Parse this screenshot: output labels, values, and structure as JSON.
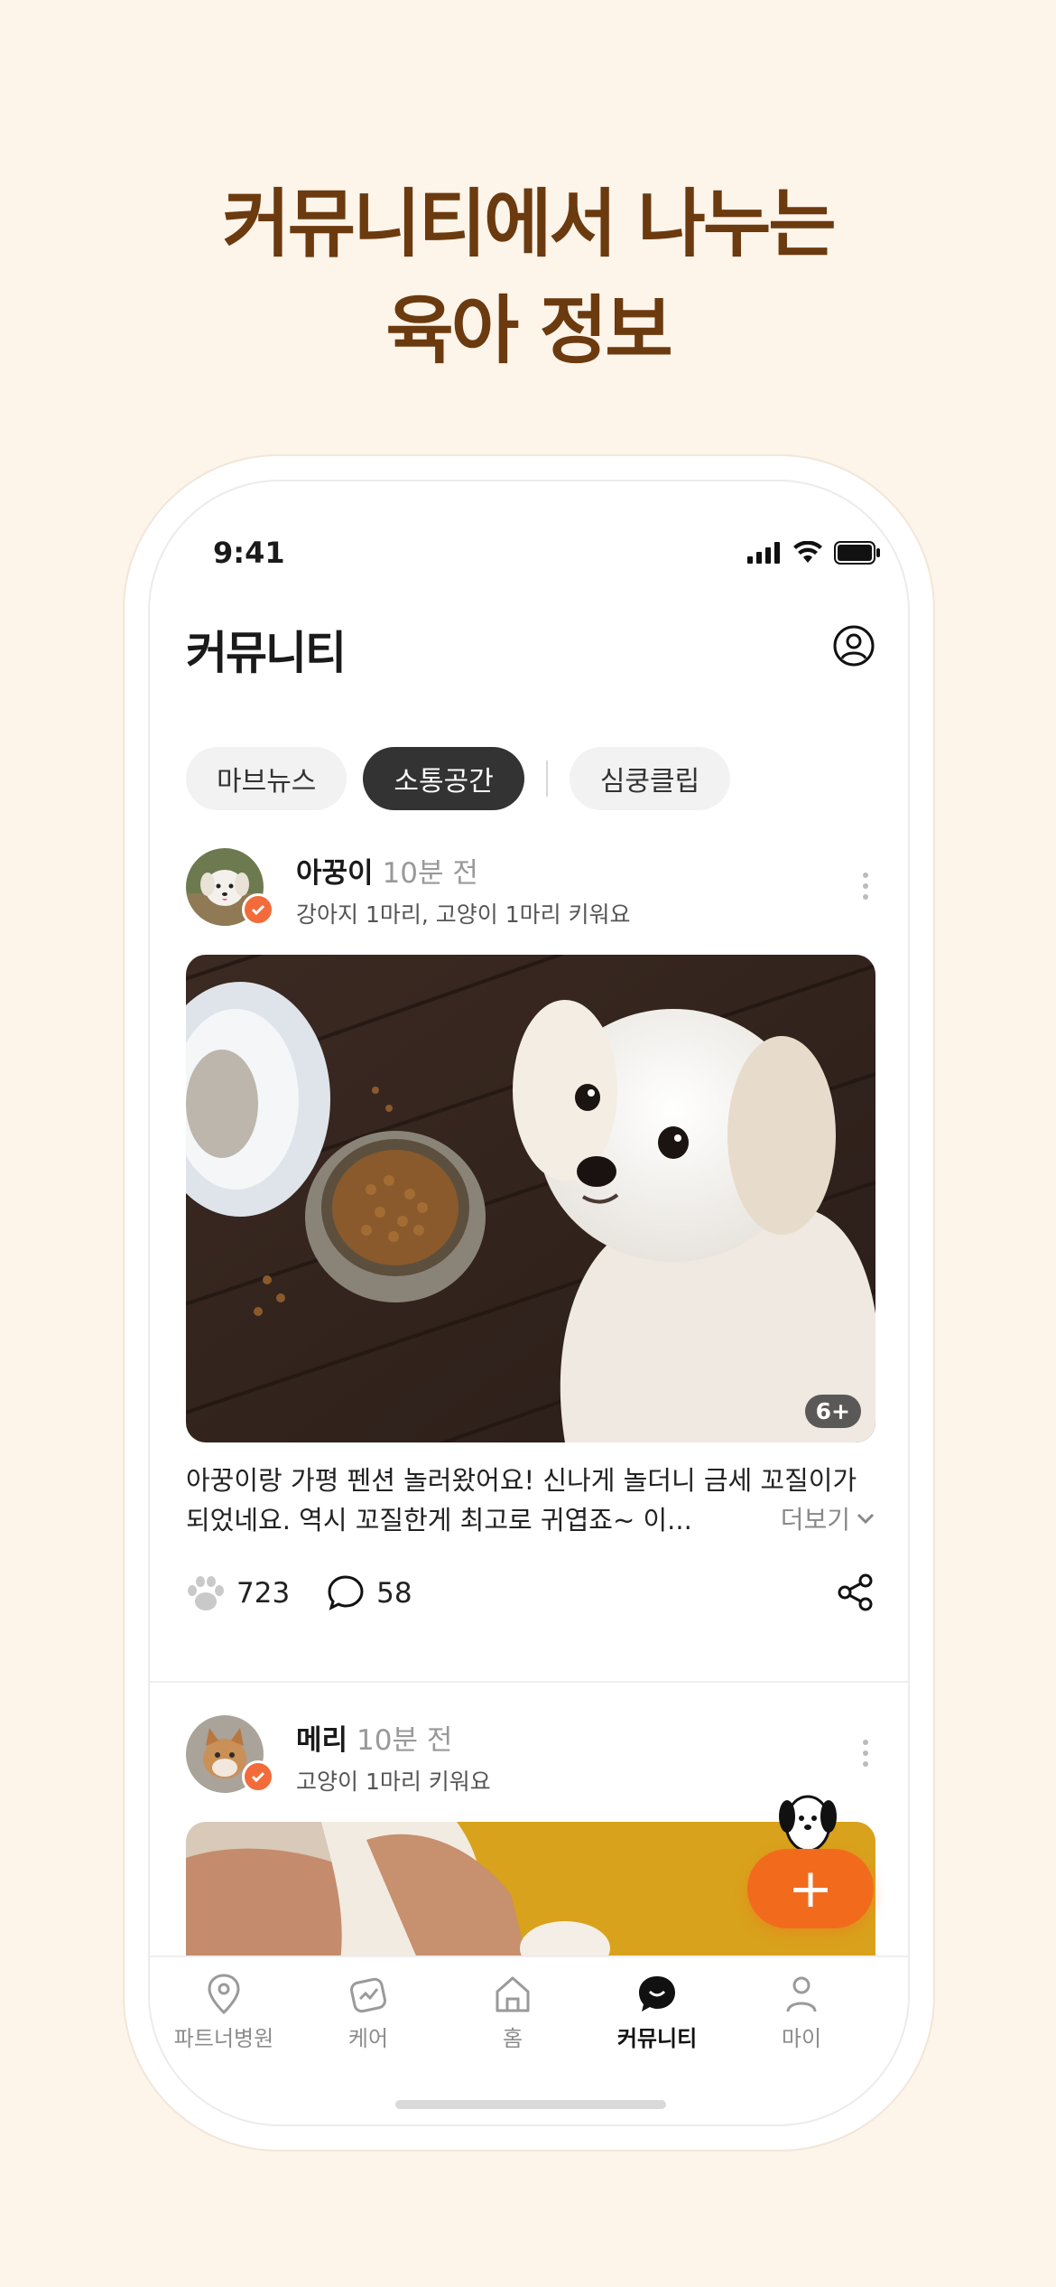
{
  "headline": {
    "line1": "커뮤니티에서 나누는",
    "line2": "육아 정보"
  },
  "status_bar": {
    "time": "9:41"
  },
  "app_bar": {
    "title": "커뮤니티"
  },
  "tabs": [
    {
      "label": "마브뉴스",
      "active": false
    },
    {
      "label": "소통공간",
      "active": true
    },
    {
      "label": "심쿵클립",
      "active": false
    }
  ],
  "posts": [
    {
      "author": "아꿍이",
      "time_ago": "10분 전",
      "bio": "강아지 1마리, 고양이 1마리 키워요",
      "photo_count": "6+",
      "caption": "아꿍이랑 가평 펜션 놀러왔어요! 신나게 놀더니 금세 꼬질이가 되었네요. 역시 꼬질한게 최고로 귀엽죠~ 이...",
      "more_label": "더보기",
      "likes": "723",
      "comments": "58"
    },
    {
      "author": "메리",
      "time_ago": "10분 전",
      "bio": "고양이 1마리 키워요"
    }
  ],
  "fab": {
    "label": "+"
  },
  "bottom_nav": [
    {
      "label": "파트너병원",
      "icon": "location-pin-icon",
      "active": false
    },
    {
      "label": "케어",
      "icon": "care-icon",
      "active": false
    },
    {
      "label": "홈",
      "icon": "home-icon",
      "active": false
    },
    {
      "label": "커뮤니티",
      "icon": "community-icon",
      "active": true
    },
    {
      "label": "마이",
      "icon": "person-icon",
      "active": false
    }
  ],
  "colors": {
    "accent": "#f26b1d",
    "headline": "#6b3a0e",
    "background": "#fdf4ea"
  }
}
